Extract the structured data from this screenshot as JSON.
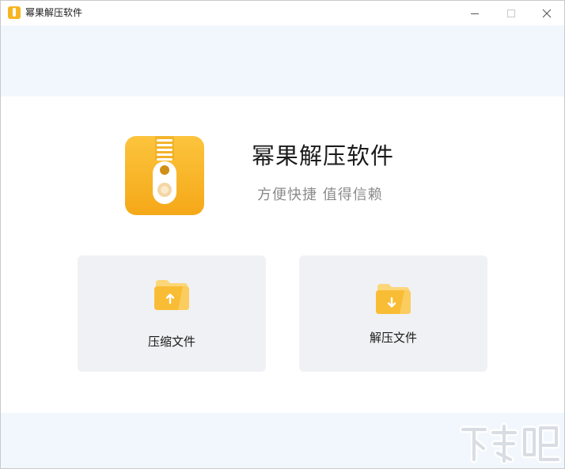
{
  "window": {
    "title": "幂果解压软件",
    "app_icon": "zipper-icon",
    "controls": [
      "minimize-icon",
      "maximize-icon",
      "close-icon"
    ]
  },
  "hero": {
    "logo_icon": "zipper-icon",
    "app_name": "幂果解压软件",
    "slogan": "方便快捷 值得信赖"
  },
  "actions": [
    {
      "label": "压缩文件",
      "icon": "folder-upload-icon"
    },
    {
      "label": "解压文件",
      "icon": "folder-download-icon"
    }
  ],
  "watermark": {
    "text": "下载吧",
    "icon": "watermark-logo"
  },
  "colors": {
    "accent": "#f7b521",
    "accent_dark": "#f5a818",
    "band": "#f2f7fd",
    "card": "#f0f1f4",
    "folder_back": "#fcd779",
    "folder_front": "#f9bc35"
  }
}
